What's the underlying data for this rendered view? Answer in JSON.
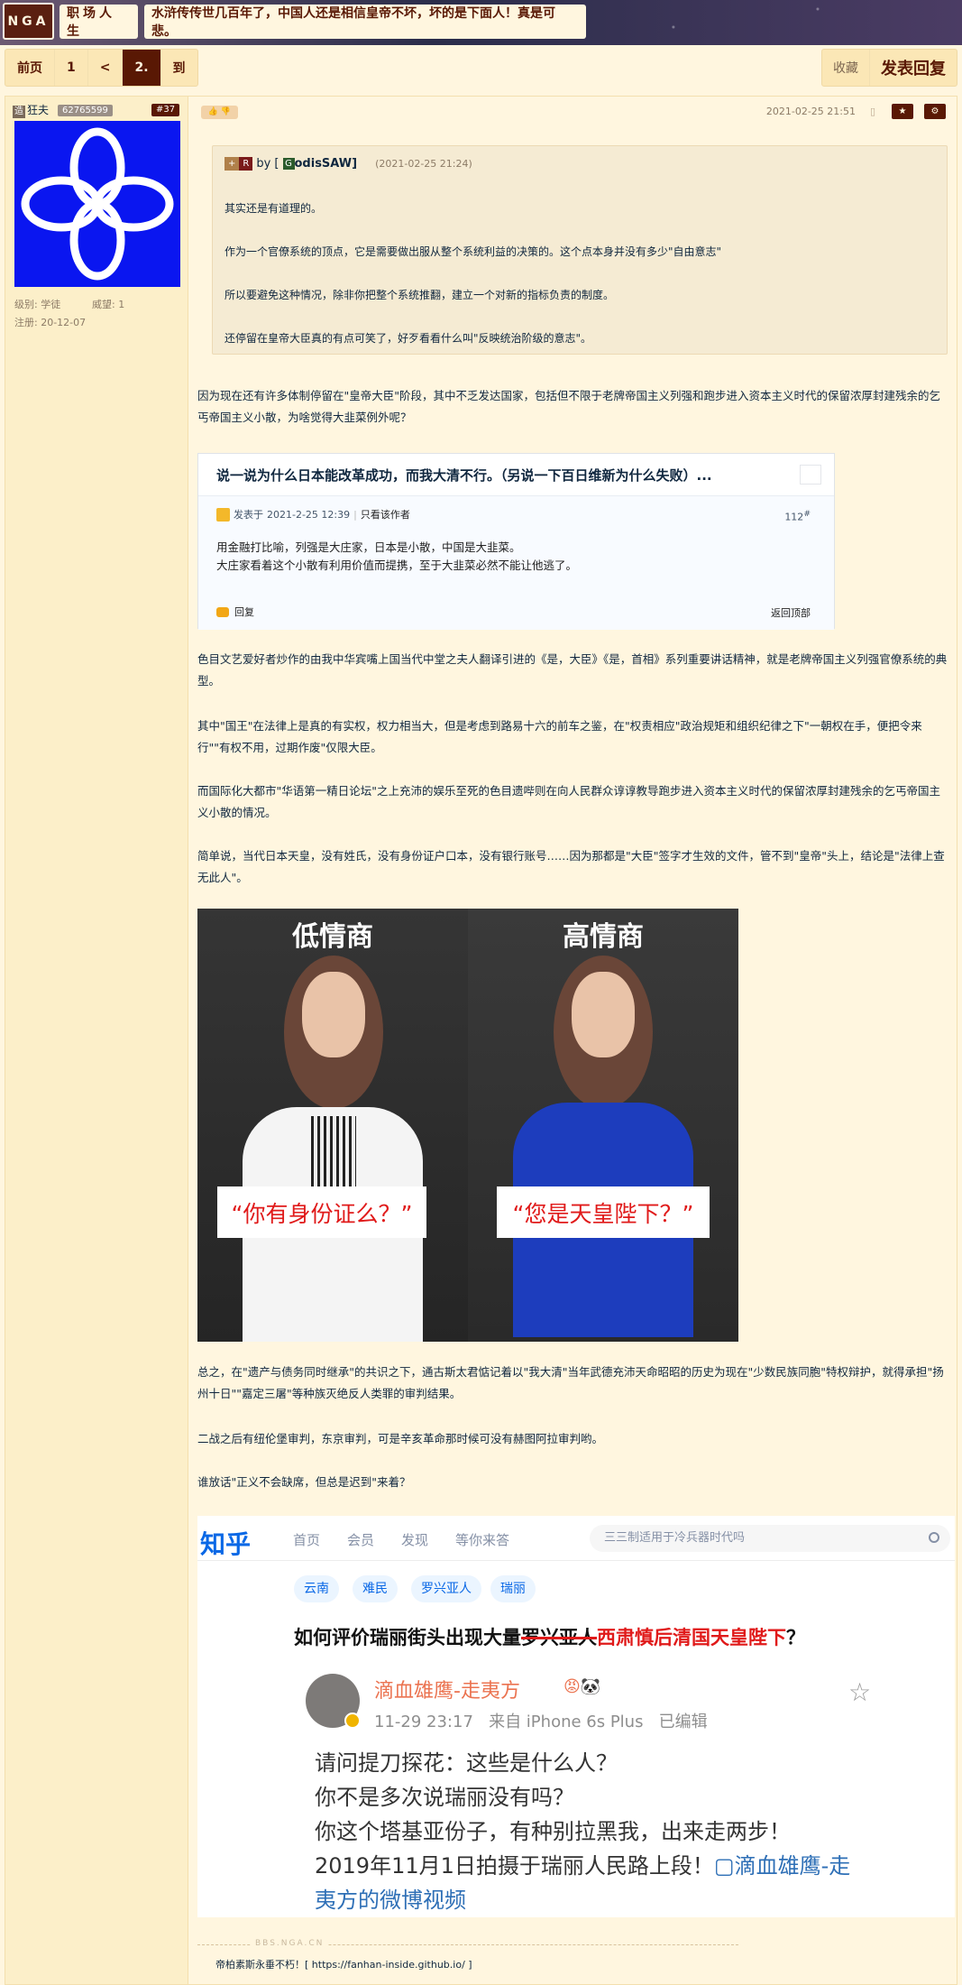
{
  "header": {
    "logo": "NGA",
    "forum": "职场人生",
    "thread_title": "水浒传传世几百年了，中国人还是相信皇帝不坏，坏的是下面人！真是可悲。"
  },
  "pager": {
    "prev": "前页",
    "p1": "1",
    "lt": "<",
    "current": "2.",
    "goto": "到"
  },
  "actions": {
    "favorite": "收藏",
    "reply": "发表回复"
  },
  "user": {
    "mark": "造",
    "name": "狂夫",
    "uid": "62765599",
    "floor": "#37",
    "level_label": "级别: 学徒",
    "prestige_label": "威望: 1",
    "register_label": "注册: 20-12-07"
  },
  "post": {
    "date": "2021-02-25 21:51",
    "likes": "👍 👎",
    "phone_icon": "▯",
    "btn_star": "★",
    "btn_gear": "⚙"
  },
  "quote": {
    "badge_plus": "+",
    "badge_r": "R",
    "by": "by [",
    "author_icon": "G",
    "author": "odisSAW]",
    "time": "(2021-02-25 21:24)",
    "lines": [
      "其实还是有道理的。",
      "作为一个官僚系统的顶点，它是需要做出服从整个系统利益的决策的。这个点本身并没有多少\"自由意志\"",
      "所以要避免这种情况，除非你把整个系统推翻，建立一个对新的指标负责的制度。",
      "还停留在皇帝大臣真的有点可笑了，好歹看看什么叫\"反映统治阶级的意志\"。"
    ]
  },
  "paragraphs": {
    "p1": "因为现在还有许多体制停留在\"皇帝大臣\"阶段，其中不乏发达国家，包括但不限于老牌帝国主义列强和跑步进入资本主义时代的保留浓厚封建残余的乞丐帝国主义小散，为啥觉得大韭菜例外呢？",
    "p2": "色目文艺爱好者炒作的由我中华宾嘴上国当代中堂之夫人翻译引进的《是，大臣》《是，首相》系列重要讲话精神，就是老牌帝国主义列强官僚系统的典型。",
    "p3": "其中\"国王\"在法律上是真的有实权，权力相当大，但是考虑到路易十六的前车之鉴，在\"权责相应\"政治规矩和组织纪律之下\"一朝权在手，便把令来行\"\"有权不用，过期作废\"仅限大臣。",
    "p4": "而国际化大都市\"华语第一精日论坛\"之上充沛的娱乐至死的色目遗哔则在向人民群众谆谆教导跑步进入资本主义时代的保留浓厚封建残余的乞丐帝国主义小散的情况。",
    "p5": "简单说，当代日本天皇，没有姓氏，没有身份证户口本，没有银行账号……因为那都是\"大臣\"签字才生效的文件，管不到\"皇帝\"头上，结论是\"法律上查无此人\"。",
    "p6": "总之，在\"遗产与债务同时继承\"的共识之下，通古斯太君惦记着以\"我大清\"当年武德充沛天命昭昭的历史为现在\"少数民族同胞\"特权辩护，就得承担\"扬州十日\"\"嘉定三屠\"等种族灭绝反人类罪的审判结果。",
    "p7": "二战之后有纽伦堡审判，东京审判，可是辛亥革命那时候可没有赫图阿拉审判哟。",
    "p8": "谁放话\"正义不会缺席，但总是迟到\"来着？"
  },
  "card": {
    "title": "说一说为什么日本能改革成功，而我大清不行。（另说一下百日维新为什么失败）...",
    "posted_prefix": "发表于",
    "posted_time": "2021-2-25 12:39",
    "only_author": "只看该作者",
    "floor_num": "112",
    "floor_sup": "#",
    "line1": "用金融打比喻，列强是大庄家，日本是小散，中国是大韭菜。",
    "line2": "大庄家看着这个小散有利用价值而提携，至于大韭菜必然不能让他逃了。",
    "reply": "回复",
    "back_top": "返回顶部"
  },
  "meme": {
    "left_label": "低情商",
    "right_label": "高情商",
    "left_caption": "“你有身份证么？”",
    "right_caption": "“您是天皇陛下？”",
    "colors": {
      "left_outfit": "#f4f4f4",
      "right_outfit": "#1d3dbd",
      "caption_red": "#e01a1a"
    }
  },
  "zhihu": {
    "logo": "知乎",
    "nav": [
      "首页",
      "会员",
      "发现",
      "等你来答"
    ],
    "search_placeholder": "三三制适用于冷兵器时代吗",
    "tags": [
      "云南",
      "难民",
      "罗兴亚人",
      "瑞丽"
    ],
    "q_prefix": "如何评价瑞丽街头出现大量",
    "q_strike": "罗兴亚人",
    "q_red": "西肃慎后清国天皇陛下",
    "q_suffix": "？",
    "author": "滴血雄鹰-走夷方",
    "author_icons": "😡🐼",
    "star": "☆",
    "meta_time": "11-29 23:17",
    "meta_from": "来自 iPhone 6s Plus",
    "meta_edit": "已编辑",
    "lines": [
      "请问提刀探花：这些是什么人？",
      "你不是多次说瑞丽没有吗？",
      "你这个塔基亚份子，有种别拉黑我，出来走两步！"
    ],
    "line4_text": "2019年11月1日拍摄于瑞丽人民路上段！",
    "line4_link": "▢滴血雄鹰-走",
    "line5_link": "夷方的微博视频"
  },
  "signature": {
    "site": "BBS.NGA.CN",
    "text": "帝柏素斯永垂不朽！[ https://fanhan-inside.github.io/ ]"
  }
}
